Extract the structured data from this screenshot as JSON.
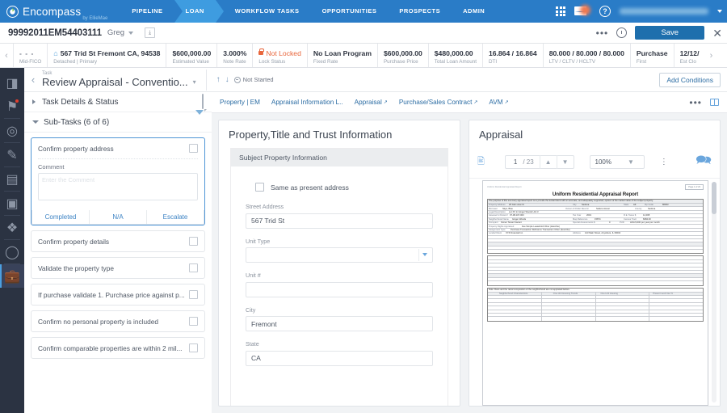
{
  "topnav": {
    "brand": "Encompass",
    "brand_sub": "by EllieMae",
    "items": [
      {
        "label": "PIPELINE",
        "active": false
      },
      {
        "label": "LOAN",
        "active": true
      },
      {
        "label": "WORKFLOW TASKS",
        "active": false
      },
      {
        "label": "OPPORTUNITIES",
        "active": false
      },
      {
        "label": "PROSPECTS",
        "active": false
      },
      {
        "label": "ADMIN",
        "active": false
      }
    ],
    "icons": [
      "apps-grid-icon",
      "messages-icon",
      "help-icon"
    ],
    "user_label": ""
  },
  "loanbar": {
    "loan_id": "99992011EM54403111",
    "borrower": "Greg",
    "more_label": "•••",
    "save_label": "Save",
    "close_label": "✕"
  },
  "summary": {
    "cells": [
      {
        "value": "- - -",
        "label": "Mid-FICO",
        "style": "muted"
      },
      {
        "value": "567 Trid St Fremont CA, 94538",
        "label": "Detached | Primary",
        "style": "home"
      },
      {
        "value": "$600,000.00",
        "label": "Estimated Value",
        "style": "plain"
      },
      {
        "value": "3.000%",
        "label": "Note Rate",
        "style": "plain"
      },
      {
        "value": "Not Locked",
        "label": "Lock Status",
        "style": "lock"
      },
      {
        "value": "No Loan Program",
        "label": "Fixed Rate",
        "style": "plain"
      },
      {
        "value": "$600,000.00",
        "label": "Purchase Price",
        "style": "plain"
      },
      {
        "value": "$480,000.00",
        "label": "Total Loan Amount",
        "style": "plain"
      },
      {
        "value": "16.864 / 16.864",
        "label": "DTI",
        "style": "plain"
      },
      {
        "value": "80.000 / 80.000 / 80.000",
        "label": "LTV / CLTV / HCLTV",
        "style": "plain"
      },
      {
        "value": "Purchase",
        "label": "First",
        "style": "plain"
      },
      {
        "value": "12/12/",
        "label": "Est Clo",
        "style": "plain"
      }
    ]
  },
  "rail": {
    "items": [
      {
        "name": "panel-toggle-icon",
        "glyph": "◨",
        "selected": false,
        "badge": false
      },
      {
        "name": "alerts-icon",
        "glyph": "⚑",
        "selected": false,
        "badge": true
      },
      {
        "name": "loan-value-icon",
        "glyph": "◎",
        "selected": false,
        "badge": false
      },
      {
        "name": "edit-pencil-icon",
        "glyph": "✎",
        "selected": false,
        "badge": false
      },
      {
        "name": "documents-icon",
        "glyph": "▤",
        "selected": false,
        "badge": false
      },
      {
        "name": "forms-icon",
        "glyph": "▣",
        "selected": false,
        "badge": false
      },
      {
        "name": "tools-icon",
        "glyph": "❖",
        "selected": false,
        "badge": false
      },
      {
        "name": "conversations-icon",
        "glyph": "○",
        "selected": false,
        "badge": false
      },
      {
        "name": "workflow-briefcase-icon",
        "glyph": "▬",
        "selected": true,
        "badge": false
      }
    ]
  },
  "task": {
    "kicker": "Task",
    "title": "Review Appraisal - Conventio...",
    "status": "Not Started",
    "add_conditions_label": "Add Conditions",
    "sections": [
      {
        "label": "Task Details & Status",
        "open": false
      },
      {
        "label": "Sub-Tasks (6 of 6)",
        "open": true
      }
    ]
  },
  "subtasks": {
    "comment_label": "Comment",
    "comment_placeholder": "Enter the Comment",
    "actions": [
      "Completed",
      "N/A",
      "Escalate"
    ],
    "items": [
      {
        "label": "Confirm property address",
        "active": true,
        "checked": false
      },
      {
        "label": "Confirm property details",
        "active": false,
        "checked": false
      },
      {
        "label": "Validate the property type",
        "active": false,
        "checked": false
      },
      {
        "label": "If purchase validate 1. Purchase price against p...",
        "active": false,
        "checked": false
      },
      {
        "label": "Confirm no personal property is included",
        "active": false,
        "checked": false
      },
      {
        "label": "Confirm comparable properties are within 2 mil...",
        "active": false,
        "checked": false
      }
    ]
  },
  "tabs": {
    "items": [
      {
        "label": "Property | EM",
        "external": false
      },
      {
        "label": "Appraisal Information L..",
        "external": false
      },
      {
        "label": "Appraisal",
        "external": true
      },
      {
        "label": "Purchase/Sales Contract",
        "external": true
      },
      {
        "label": "AVM",
        "external": true
      }
    ],
    "more_label": "•••"
  },
  "property_panel": {
    "title": "Property,Title and Trust Information",
    "section_title": "Subject Property Information",
    "same_address_label": "Same as present address",
    "fields": [
      {
        "label": "Street Address",
        "value": "567 Trid St",
        "type": "text"
      },
      {
        "label": "Unit Type",
        "value": "",
        "type": "select"
      },
      {
        "label": "Unit #",
        "value": "",
        "type": "text"
      },
      {
        "label": "City",
        "value": "Fremont",
        "type": "text"
      },
      {
        "label": "State",
        "value": "CA",
        "type": "text"
      }
    ]
  },
  "appraisal_panel": {
    "title": "Appraisal",
    "page_current": "1",
    "page_total": "/ 23",
    "zoom_value": "100%",
    "document": {
      "header_tiny": "Uniform Residential Appraisal Report",
      "title": "Uniform Residential Appraisal Report",
      "file_no_label": "File #",
      "file_no": "ABC123",
      "file_ref": "File # CONV_1004_DEMO",
      "page_chip": "Page 1 of 23",
      "purpose_text": "The purpose of this summary appraisal report is to provide the lender/client with an accurate, and adequately supported, opinion of the market value of the subject property.",
      "rows": [
        {
          "label": "Property Address",
          "value": "20 Glen view Ct",
          "label2": "City",
          "value2": "Sedona",
          "label3": "State",
          "value3": "AZ",
          "label4": "Zip Code",
          "value4": "86003"
        },
        {
          "label": "Borrower",
          "value": "Skye, Blue",
          "label2": "Owner of Public Record",
          "value2": "Sellers Homer",
          "label3": "County",
          "value3": "Sedona"
        },
        {
          "label": "Legal Description",
          "value": "Lot XX in Ginger Woods Unit 3"
        },
        {
          "label": "Assessor's Parcel #",
          "value": "07-08-107-003",
          "label2": "Tax Year",
          "value2": "2019",
          "label3": "R.E. Taxes $",
          "value3": "14,008"
        },
        {
          "label": "Neighborhood Name",
          "value": "Ginger Woods",
          "label2": "Map Reference",
          "value2": "15874",
          "label3": "Census Tract",
          "value3": "8484.00"
        },
        {
          "label": "Occupant",
          "value": "Owner  Tenant  Vacant",
          "label2": "Special Assessments $",
          "value2": "0",
          "label3": "PUD",
          "value3": "HOA $ 300  per year  per month"
        },
        {
          "label": "Property Rights Appraised",
          "value": "Fee Simple  Leasehold  Other (describe)"
        },
        {
          "label": "Assignment Type",
          "value": "Purchase Transaction  Refinance Transaction  Other (describe)"
        },
        {
          "label": "Lender/Client",
          "value": "XYZ Financial Inc.",
          "label2": "Address",
          "value2": "123 Main Street, Anywhere, IL 60004"
        }
      ],
      "note_text": "Note: Race and the racial composition of the neighborhood are not appraisal factors.",
      "grid_headers": [
        "Neighborhood Characteristics",
        "One-Unit Housing Trends",
        "One-Unit Housing",
        "Present Land Use %"
      ]
    }
  }
}
